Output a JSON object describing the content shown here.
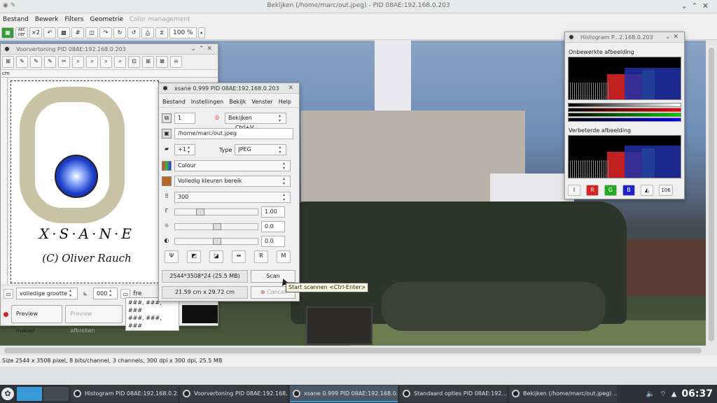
{
  "main": {
    "title": "Bekijken (/home/marc/out.jpeg) - PID 08AE:192.168.0.203",
    "menu": [
      "Bestand",
      "Bewerk",
      "Filters",
      "Geometrie"
    ],
    "menu_disabled": "Color management",
    "toolbar": [
      "ABC DEF",
      "×2"
    ],
    "zoom": "100 %",
    "status": "Size 2544 x 3508 pixel, 8 bits/channel, 3 channels, 300 dpi x 300 dpi, 25.5 MB"
  },
  "preview": {
    "title": "Voorvertoning PID 08AE:192.168.0.203",
    "ruler_unit": "cm",
    "logo_name": "X·S·A·N·E",
    "logo_credit": "(C) Oliver Rauch",
    "size_combo": "volledige grootte",
    "rotation_combo": "000",
    "free_label": "fre",
    "preview_button": "Preview maken",
    "cancel_preview_button": "Preview afbreken",
    "hash_lines": [
      "###, ###, ###",
      "###, ###, ###"
    ]
  },
  "xsane": {
    "title": "xsane 0.999 PID 08AE:192.168.0.203",
    "menu": [
      "Bestand",
      "Instellingen",
      "Bekijk",
      "Venster",
      "Help"
    ],
    "copies": "1",
    "mode_combo": "Bekijken",
    "mode_shortcut": "Ctrl+V",
    "filename": "/home/marc/out.jpeg",
    "step": "+1",
    "type_label": "Type",
    "type_combo": "JPEG",
    "color_combo": "Colour",
    "range_combo": "Volledig kleuren bereik",
    "resolution": "300",
    "gamma_value": "1.00",
    "brightness_value": "0.0",
    "contrast_value": "0.0",
    "info_size": "2544*3508*24 (25.5 MB)",
    "info_dims": "21.59 cm x 29.72 cm",
    "scan_button": "Scan",
    "cancel_button": "Cancel",
    "tooltip": "Start scannen <Ctrl-Enter>"
  },
  "histogram": {
    "title": "Histogram P...2.168.0.203",
    "raw_label": "Onbewerkte afbeelding",
    "enhanced_label": "Verbeterde afbeelding",
    "buttons": [
      "I",
      "R",
      "G",
      "B"
    ],
    "value_button": "106"
  },
  "taskbar": {
    "tasks": [
      "Histogram PID 08AE:192.168.0.2...",
      "Voorvertoning PID 08AE:192.168....",
      "xsane 0.999 PID 08AE:192.168.0....",
      "Standaard opties PID 08AE:192....",
      "Bekijken (/home/marc/out.jpeg) ..."
    ],
    "active_index": 2,
    "clock": "06:37"
  },
  "colors": {
    "accent": "#3a9ad9",
    "taskbar_bg": "#2f3238",
    "tooltip_bg": "#fffbe0"
  }
}
